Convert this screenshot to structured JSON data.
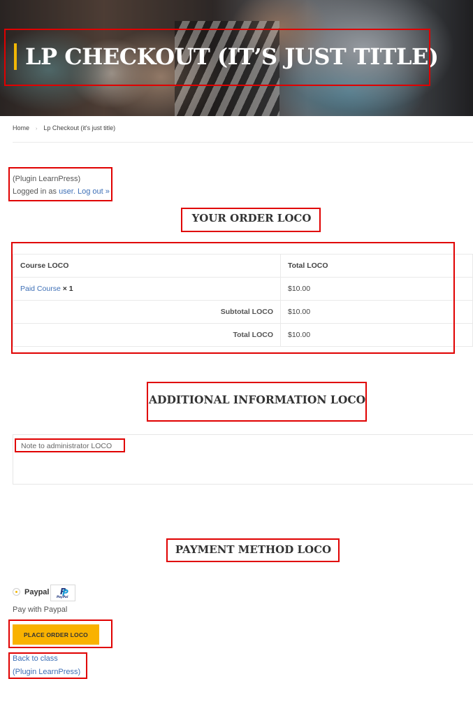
{
  "header": {
    "title": "LP CHECKOUT (IT’S JUST TITLE)"
  },
  "breadcrumb": {
    "home": "Home",
    "separator": "›",
    "current": "Lp Checkout (it's just title)"
  },
  "login": {
    "plugin_note": "(Plugin LearnPress)",
    "logged_in_prefix": "Logged in as",
    "user_link": "user.",
    "logout_link": "Log out »"
  },
  "order": {
    "heading": "YOUR ORDER LOCO",
    "columns": [
      "Course LOCO",
      "Total LOCO"
    ],
    "item": {
      "name": "Paid Course",
      "qty": "× 1",
      "total": "$10.00"
    },
    "subtotal_label": "Subtotal LOCO",
    "subtotal_value": "$10.00",
    "total_label": "Total LOCO",
    "total_value": "$10.00"
  },
  "additional": {
    "heading": "ADDITIONAL INFORMATION LOCO",
    "note_placeholder": "Note to administrator LOCO"
  },
  "payment": {
    "heading": "PAYMENT METHOD LOCO",
    "method_label": "Paypal",
    "logo_text": "PayPal",
    "method_description": "Pay with Paypal",
    "place_order_label": "PLACE ORDER LOCO"
  },
  "footer_links": {
    "back": "Back to class",
    "plugin_note": "(Plugin LearnPress)"
  },
  "colors": {
    "accent": "#f9b200",
    "link": "#3d6fb6",
    "annotation_box": "#e00000"
  }
}
